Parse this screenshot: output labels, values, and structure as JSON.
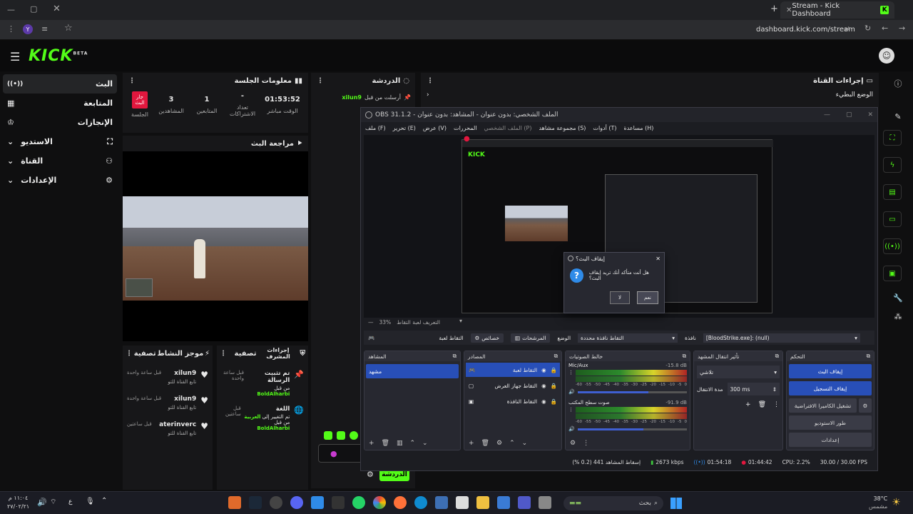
{
  "browser": {
    "tab_title": "Stream - Kick Dashboard",
    "url": "dashboard.kick.com/stream"
  },
  "kick": {
    "logo_text": "KICK",
    "logo_beta": "BETA",
    "nav": [
      {
        "label": "البث",
        "icon": "live-icon"
      },
      {
        "label": "المتابعة",
        "icon": "grid-icon"
      },
      {
        "label": "الإنجازات",
        "icon": "trophy-icon"
      },
      {
        "label": "الاستديو",
        "icon": "studio-icon"
      },
      {
        "label": "القناة",
        "icon": "channel-icon"
      },
      {
        "label": "الإعدادات",
        "icon": "gear-icon"
      }
    ],
    "session_info": {
      "title": "معلومات الجلسة",
      "live_badge": "جار البث",
      "live_label": "الجلسة",
      "stats": [
        {
          "value": "3",
          "label": "المشاهدين"
        },
        {
          "value": "1",
          "label": "المتابعين"
        },
        {
          "value": "-",
          "label": "تعداد الاشتراكات"
        },
        {
          "value": "01:53:52",
          "label": "الوقت مباشر"
        }
      ]
    },
    "stream_preview_title": "مراجعة البث",
    "activity_feed": {
      "title": "موجز النشاط",
      "filter": "تصفية",
      "items": [
        {
          "name": "xilun9",
          "text": "تابع القناة للتو",
          "time": "قبل ساعة واحدة"
        },
        {
          "name": "xilun9",
          "text": "تابع القناة للتو",
          "time": "قبل ساعة واحدة"
        },
        {
          "name": "aterinverc",
          "text": "تابع القناة للتو",
          "time": "قبل ساعتين"
        }
      ]
    },
    "mod_actions": {
      "title": "إجراءات المشرف",
      "filter": "تصفية",
      "items": [
        {
          "title": "تم تثبيت الرسالة",
          "sub1": "من قبل",
          "user": "BoldAlharbi",
          "time": "قبل ساعة واحدة"
        },
        {
          "title": "اللغة",
          "sub1": "تم التغيير إلى",
          "highlight": "العربية",
          "sub2": "من قبل",
          "user": "BoldAlharbi",
          "time": "قبل ساعتين"
        }
      ]
    },
    "chat": {
      "title": "الدردشة",
      "pinned_by": "أرسلت من قبل",
      "pinned_user": "xilun9",
      "pinned_msg": "-",
      "send_button": "الدردشة"
    },
    "channel_actions": {
      "title": "إجراءات القناة",
      "sub": "الوضع البطيء"
    }
  },
  "obs": {
    "title": "OBS 31.1.2 - الملف الشخصي: بدون عنوان - المشاهد: بدون عنوان",
    "menu": [
      "ملف (F)",
      "تحرير (E)",
      "عرض (V)",
      "المحررات",
      "الملف الشخصي (P)",
      "مجموعة مشاهد (S)",
      "أدوات (T)",
      "مساعدة (H)"
    ],
    "zoom": "33%",
    "preview_label": "التعريف لعبة التقاط",
    "dialog": {
      "title": "إيقاف البث؟",
      "message": "هل أنت متأكد أنك تريد إيقاف البث؟",
      "yes": "نعم",
      "no": "لا"
    },
    "source_bar": {
      "window": "[BloodStrike.exe]: (null)",
      "window_label": "نافذة",
      "mode_label": "الوضع",
      "mode_value": "التقاط نافذة محددة",
      "filters": "المرشحات",
      "properties": "خصائص",
      "game_capture": "التقاط لعبة"
    },
    "scenes": {
      "title": "المشاهد",
      "items": [
        "مشهد"
      ]
    },
    "sources": {
      "title": "المصادر",
      "items": [
        "التقاط لعبة",
        "التقاط جهاز العرض",
        "التقاط النافذة"
      ]
    },
    "mixer": {
      "title": "خالط الصوتيات",
      "channels": [
        {
          "name": "Mic/Aux",
          "db": "-15.8 dB",
          "level": 0.65
        },
        {
          "name": "صوت سطح المكتب",
          "db": "-91.9 dB",
          "level": 0.6
        }
      ],
      "ticks": [
        "-60",
        "-55",
        "-50",
        "-45",
        "-40",
        "-35",
        "-30",
        "-25",
        "-20",
        "-15",
        "-10",
        "-5",
        "0"
      ]
    },
    "transitions": {
      "title": "تأثير انتقال المشهد",
      "value": "تلاشي",
      "duration_label": "مدة الانتقال",
      "duration": "300 ms"
    },
    "controls": {
      "title": "التحكم",
      "buttons": [
        "إيقاف البث",
        "إيقاف التسجيل",
        "تشغيل الكاميرا الافتراضية",
        "طور الاستوديو",
        "إعدادات"
      ]
    },
    "status": {
      "dropped": "إسقاط المشاهد 441 (0.2 %)",
      "bitrate": "2673 kbps",
      "rec_time": "01:54:18",
      "live_time": "01:44:42",
      "cpu": "CPU: 2.2%",
      "fps": "30.00 / 30.00 FPS"
    }
  },
  "taskbar": {
    "search": "بحث",
    "weather_temp": "38°C",
    "weather_desc": "مشمس",
    "time": "١١:٠٤ م",
    "date": "٢٧/٠٢/٢١",
    "lang": "ع"
  }
}
